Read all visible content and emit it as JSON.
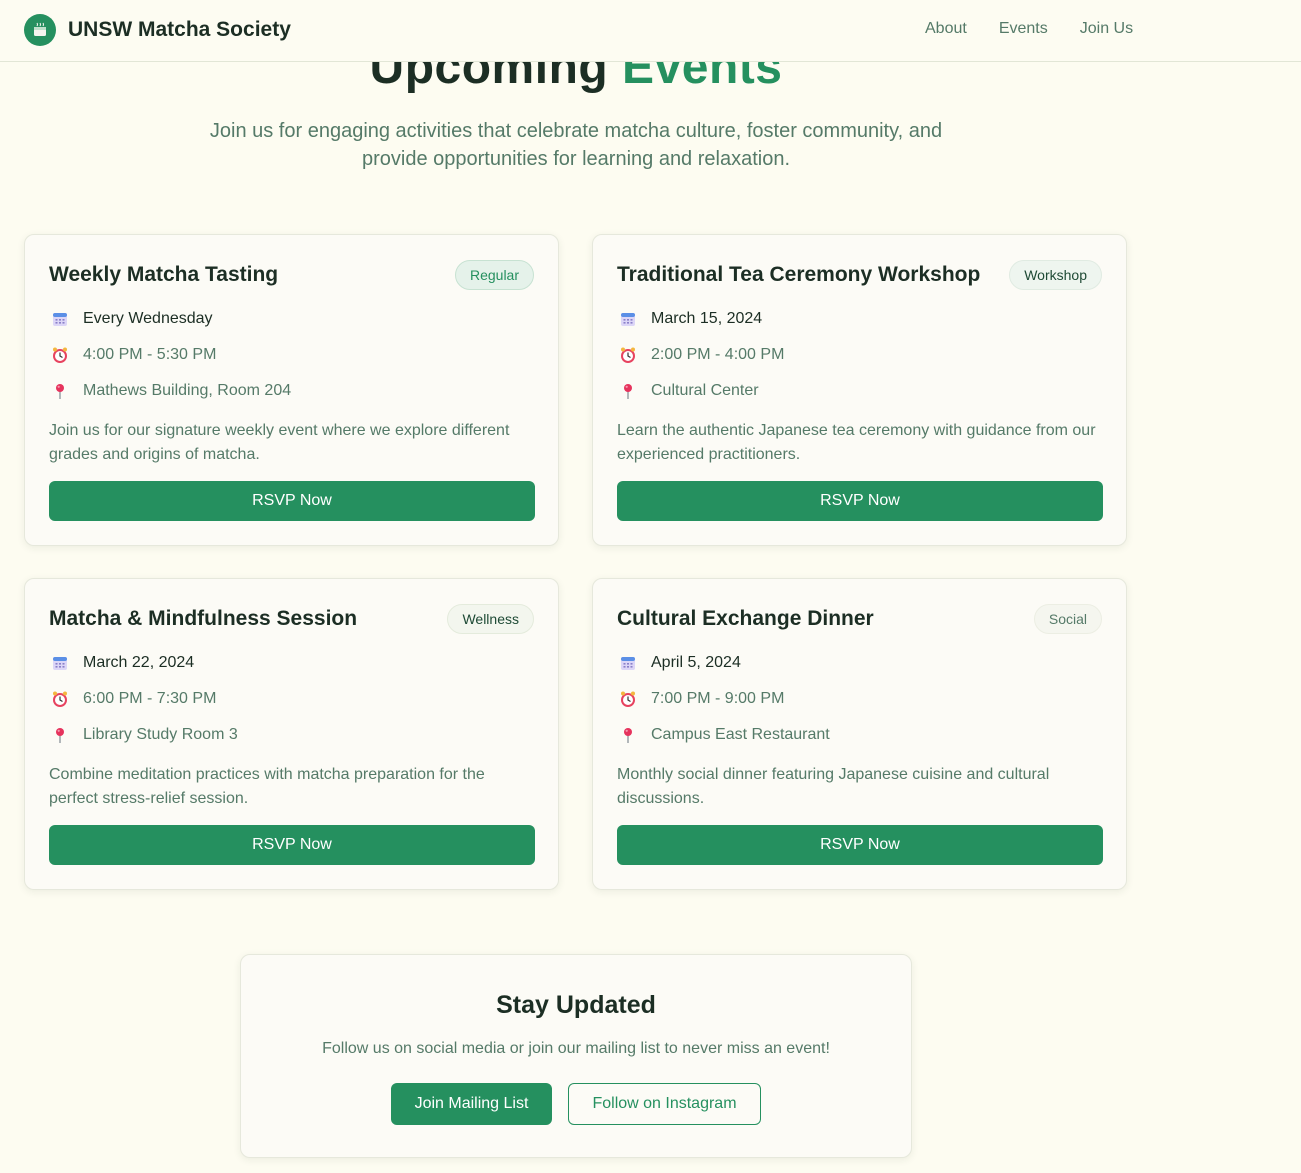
{
  "nav": {
    "brand": "UNSW Matcha Society",
    "links": [
      "About",
      "Events",
      "Join Us"
    ]
  },
  "hero": {
    "title_main": "Upcoming",
    "title_accent": "Events",
    "subtitle": "Join us for engaging activities that celebrate matcha culture, foster community, and provide opportunities for learning and relaxation."
  },
  "events": [
    {
      "title": "Weekly Matcha Tasting",
      "badge": "Regular",
      "date": "Every Wednesday",
      "time": "4:00 PM - 5:30 PM",
      "location": "Mathews Building, Room 204",
      "description": "Join us for our signature weekly event where we explore different grades and origins of matcha.",
      "rsvp": "RSVP Now"
    },
    {
      "title": "Traditional Tea Ceremony Workshop",
      "badge": "Workshop",
      "date": "March 15, 2024",
      "time": "2:00 PM - 4:00 PM",
      "location": "Cultural Center",
      "description": "Learn the authentic Japanese tea ceremony with guidance from our experienced practitioners.",
      "rsvp": "RSVP Now"
    },
    {
      "title": "Matcha & Mindfulness Session",
      "badge": "Wellness",
      "date": "March 22, 2024",
      "time": "6:00 PM - 7:30 PM",
      "location": "Library Study Room 3",
      "description": "Combine meditation practices with matcha preparation for the perfect stress-relief session.",
      "rsvp": "RSVP Now"
    },
    {
      "title": "Cultural Exchange Dinner",
      "badge": "Social",
      "date": "April 5, 2024",
      "time": "7:00 PM - 9:00 PM",
      "location": "Campus East Restaurant",
      "description": "Monthly social dinner featuring Japanese cuisine and cultural discussions.",
      "rsvp": "RSVP Now"
    }
  ],
  "stay": {
    "title": "Stay Updated",
    "subtitle": "Follow us on social media or join our mailing list to never miss an event!",
    "primary_button": "Join Mailing List",
    "secondary_button": "Follow on Instagram"
  },
  "icons": {
    "logo": "matcha-cup-icon",
    "date": "calendar-icon",
    "time": "alarm-clock-icon",
    "location": "pin-icon"
  },
  "colors": {
    "accent": "#25905f",
    "background": "#fdfcf1",
    "text_dark": "#1c2e24",
    "text_muted": "#557a68"
  }
}
